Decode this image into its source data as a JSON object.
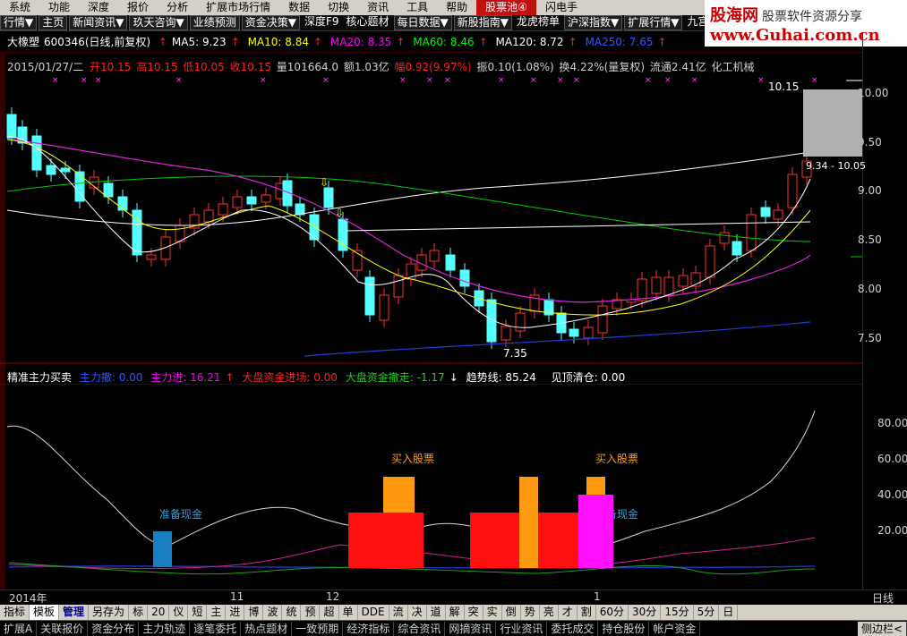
{
  "menu": {
    "items": [
      "系统",
      "功能",
      "深度",
      "报价",
      "分析",
      "扩展市场行情",
      "数据",
      "切换",
      "资讯",
      "工具",
      "帮助",
      "股票池④",
      "闪电手"
    ],
    "highlight_index": 11
  },
  "logo": {
    "brand": "股海网",
    "slogan": "股票软件资源分享",
    "url": "www.Guhai.com.cn"
  },
  "toolbar": {
    "items": [
      "行情▼",
      "主页",
      "新闻资讯▼",
      "玖天咨询▼",
      "业绩预测",
      "资金决策▼",
      "深度F9",
      "核心题材",
      "每日数据▼",
      "新股指南▼",
      "龙虎榜单",
      "沪深指数▼",
      "扩展行情▼",
      "九宫图"
    ]
  },
  "stock": {
    "name": "大橡塑",
    "code": "600346",
    "period": "(日线,前复权)",
    "ma": [
      {
        "label": "MA5: 9.23",
        "color": "#ffffff"
      },
      {
        "label": "MA10: 8.84",
        "color": "#ffff00"
      },
      {
        "label": "MA20: 8.35",
        "color": "#ff00ff"
      },
      {
        "label": "MA60: 8.46",
        "color": "#00ff00"
      },
      {
        "label": "MA120: 8.72",
        "color": "#ffffff"
      },
      {
        "label": "MA250: 7.65",
        "color": "#0000ff"
      }
    ]
  },
  "ohlc": {
    "date": "2015/01/27/二",
    "open": "开10.15",
    "high": "高10.15",
    "low": "低10.05",
    "close": "收10.15",
    "volume": "量101664.0",
    "amount": "额1.03亿",
    "change": "幅0.92(9.97%)",
    "amplitude": "振0.10(1.08%)",
    "turnover": "换4.22%(量复权)",
    "float": "流通2.41亿",
    "industry": "化工机械"
  },
  "price_axis": {
    "ticks": [
      "10.00",
      "9.50",
      "9.00",
      "8.50",
      "8.00",
      "7.50"
    ],
    "high_label": "10.15",
    "low_label": "7.35",
    "range_label": "9.34 - 10.05"
  },
  "indicator": {
    "title": "精准主力买卖",
    "items": [
      {
        "label": "主力撤: 0.00",
        "color": "#3355ff"
      },
      {
        "label": "主力进: 16.21",
        "color": "#ff00ff"
      },
      {
        "label": "大盘资金进场: 0.00",
        "color": "#ff2020"
      },
      {
        "label": "大盘资金撤走: -1.17",
        "color": "#20d020"
      },
      {
        "label": "趋势线: 85.24",
        "color": "#ffffff"
      },
      {
        "label": "见顶清仓: 0.00",
        "color": "#ffffff"
      }
    ],
    "ticks": [
      "80.00",
      "60.00",
      "40.00",
      "20.00"
    ],
    "annotations": {
      "prepare_cash": "准备现金",
      "buy_stock": "买入股票"
    }
  },
  "dates": {
    "labels": [
      "2014年",
      "11",
      "12",
      "1"
    ],
    "period": "日线"
  },
  "tabs": {
    "items": [
      "指标",
      "模板",
      "管理",
      "另存为",
      "标",
      "20",
      "仪",
      "短",
      "主",
      "进",
      "博",
      "波",
      "统",
      "预",
      "超",
      "单",
      "DDE",
      "流",
      "决",
      "道",
      "解",
      "突",
      "实",
      "倒",
      "势",
      "亮",
      "才",
      "割",
      "60分",
      "30分",
      "15分",
      "5分",
      "日"
    ],
    "active_index": 1,
    "blue_index": 2
  },
  "bottom": {
    "items": [
      "扩展A",
      "关联报价",
      "资金分布",
      "主力轨迹",
      "逐笔委托",
      "热点题材",
      "一致预期",
      "经济指标",
      "综合资讯",
      "网摘资讯",
      "行业资讯",
      "委托成交",
      "持仓股份",
      "帐户资金"
    ],
    "right_label": "侧边栏<"
  }
}
